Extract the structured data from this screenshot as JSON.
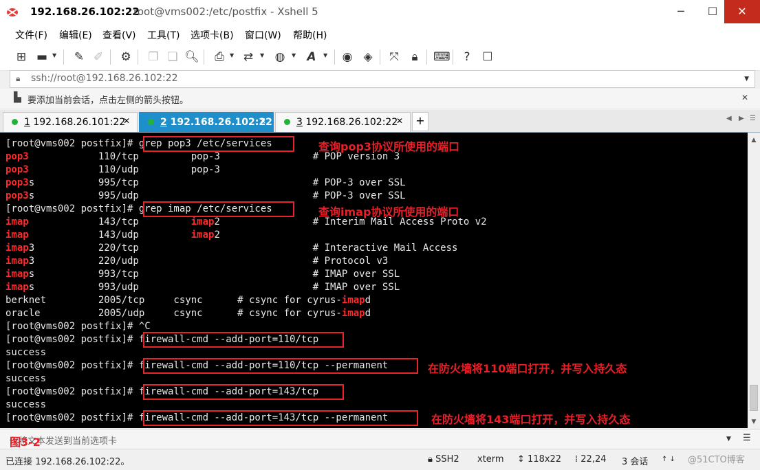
{
  "window": {
    "title_host": "192.168.26.102:22",
    "title_rest": "root@vms002:/etc/postfix - Xshell 5",
    "min": "─",
    "max": "☐",
    "close": "✕"
  },
  "menu": [
    "文件(F)",
    "编辑(E)",
    "查看(V)",
    "工具(T)",
    "选项卡(B)",
    "窗口(W)",
    "帮助(H)"
  ],
  "toolbar_icons": [
    "new-session-icon",
    "open-folder-icon",
    "reconnect-icon",
    "disconnect-icon",
    "properties-icon",
    "copy-icon",
    "paste-icon",
    "find-icon",
    "print-icon",
    "transfer-icon",
    "globe-icon",
    "font-icon",
    "xftp-icon",
    "xmanager-icon",
    "fullscreen-icon",
    "lock-icon",
    "keyboard-icon",
    "help-icon",
    "chat-icon"
  ],
  "address": {
    "value": "ssh://root@192.168.26.102:22"
  },
  "hint": {
    "text": "要添加当前会话，点击左侧的箭头按钮。"
  },
  "tabs": [
    {
      "num": "1",
      "label": " 192.168.26.101:22"
    },
    {
      "num": "2",
      "label": " 192.168.26.102:22"
    },
    {
      "num": "3",
      "label": " 192.168.26.102:22"
    }
  ],
  "tab_add": "+",
  "terminal": {
    "lines": [
      [
        {
          "t": "[root@vms002 postfix]# grep pop3 /etc/services"
        }
      ],
      [
        {
          "t": "pop3",
          "r": 1
        },
        {
          "t": "            110/tcp         pop-3                # POP version 3"
        }
      ],
      [
        {
          "t": "pop3",
          "r": 1
        },
        {
          "t": "            110/udp         pop-3"
        }
      ],
      [
        {
          "t": "pop3",
          "r": 1
        },
        {
          "t": "s           995/tcp                              # POP-3 over SSL"
        }
      ],
      [
        {
          "t": "pop3",
          "r": 1
        },
        {
          "t": "s           995/udp                              # POP-3 over SSL"
        }
      ],
      [
        {
          "t": "[root@vms002 postfix]# grep imap /etc/services"
        }
      ],
      [
        {
          "t": "imap",
          "r": 1
        },
        {
          "t": "            143/tcp         "
        },
        {
          "t": "imap",
          "r": 1
        },
        {
          "t": "2                # Interim Mail Access Proto v2"
        }
      ],
      [
        {
          "t": "imap",
          "r": 1
        },
        {
          "t": "            143/udp         "
        },
        {
          "t": "imap",
          "r": 1
        },
        {
          "t": "2"
        }
      ],
      [
        {
          "t": "imap",
          "r": 1
        },
        {
          "t": "3           220/tcp                              # Interactive Mail Access"
        }
      ],
      [
        {
          "t": "imap",
          "r": 1
        },
        {
          "t": "3           220/udp                              # Protocol v3"
        }
      ],
      [
        {
          "t": "imap",
          "r": 1
        },
        {
          "t": "s           993/tcp                              # IMAP over SSL"
        }
      ],
      [
        {
          "t": "imap",
          "r": 1
        },
        {
          "t": "s           993/udp                              # IMAP over SSL"
        }
      ],
      [
        {
          "t": "berknet         2005/tcp     csync      # csync for cyrus-"
        },
        {
          "t": "imap",
          "r": 1
        },
        {
          "t": "d"
        }
      ],
      [
        {
          "t": "oracle          2005/udp     csync      # csync for cyrus-"
        },
        {
          "t": "imap",
          "r": 1
        },
        {
          "t": "d"
        }
      ],
      [
        {
          "t": "[root@vms002 postfix]# ^C"
        }
      ],
      [
        {
          "t": "[root@vms002 postfix]# firewall-cmd --add-port=110/tcp"
        }
      ],
      [
        {
          "t": "success"
        }
      ],
      [
        {
          "t": "[root@vms002 postfix]# firewall-cmd --add-port=110/tcp --permanent"
        }
      ],
      [
        {
          "t": "success"
        }
      ],
      [
        {
          "t": "[root@vms002 postfix]# firewall-cmd --add-port=143/tcp"
        }
      ],
      [
        {
          "t": "success"
        }
      ],
      [
        {
          "t": "[root@vms002 postfix]# firewall-cmd --add-port=143/tcp --permanent"
        }
      ]
    ],
    "annotations": {
      "pop3": "查询pop3协议所使用的端口",
      "imap": "查询imap协议所使用的端口",
      "port110": "在防火墙将110端口打开，并写入持久态",
      "port143": "在防火墙将143端口打开，并写入持久态"
    }
  },
  "input_bar": {
    "placeholder": "仅将文本发送到当前选项卡",
    "figure_label": "图3-2"
  },
  "status": {
    "connected": "已连接 192.168.26.102:22。",
    "protocol": "SSH2",
    "term": "xterm",
    "size": "118x22",
    "cursor": "22,24",
    "sessions": "3 会话",
    "watermark": "@51CTO博客"
  }
}
